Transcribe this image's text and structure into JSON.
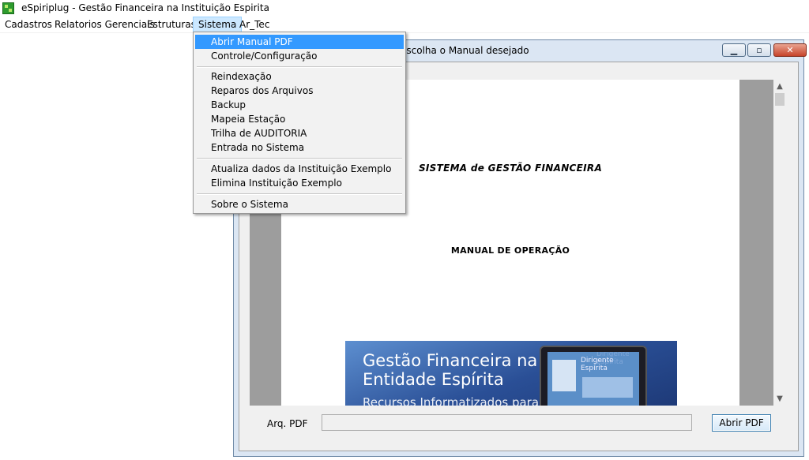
{
  "app": {
    "title": "eSpiriplug - Gestão Financeira na Instituição Espirita"
  },
  "menubar": {
    "items": [
      "Cadastros",
      "Relatorios Gerenciais",
      "Estruturas",
      "Sistema",
      "Ar_Tec"
    ],
    "active": "Sistema"
  },
  "dropdown": {
    "groups": [
      [
        "Abrir Manual PDF",
        "Controle/Configuração"
      ],
      [
        "Reindexação",
        "Reparos dos Arquivos",
        "Backup",
        "Mapeia Estação",
        "Trilha de AUDITORIA",
        "Entrada no Sistema"
      ],
      [
        "Atualiza dados da Instituição Exemplo",
        "Elimina Instituição Exemplo"
      ],
      [
        "Sobre o Sistema"
      ]
    ],
    "highlighted": "Abrir Manual PDF"
  },
  "child_window": {
    "title": "escolha o Manual desejado",
    "pdf": {
      "heading1": "SISTEMA de GESTÃO FINANCEIRA",
      "heading2": "MANUAL DE OPERAÇÃO",
      "cover": {
        "line1": "Gestão Financeira na",
        "line2": "Entidade Espírita",
        "line3": "Recursos Informatizados para",
        "tablet_brand": "Dirigente Espirita",
        "tablet_label_1": "Dirigente",
        "tablet_label_2": "Espírita"
      }
    },
    "arq_label": "Arq. PDF",
    "arq_value": "",
    "open_button": "Abrir PDF"
  },
  "colors": {
    "menu_highlight": "#3399ff",
    "close_button": "#c7432a",
    "viewer_margin": "#9d9d9d"
  },
  "icons": [
    "app-icon",
    "minimize-icon",
    "maximize-icon",
    "close-icon",
    "scroll-up-icon",
    "scroll-down-icon"
  ]
}
